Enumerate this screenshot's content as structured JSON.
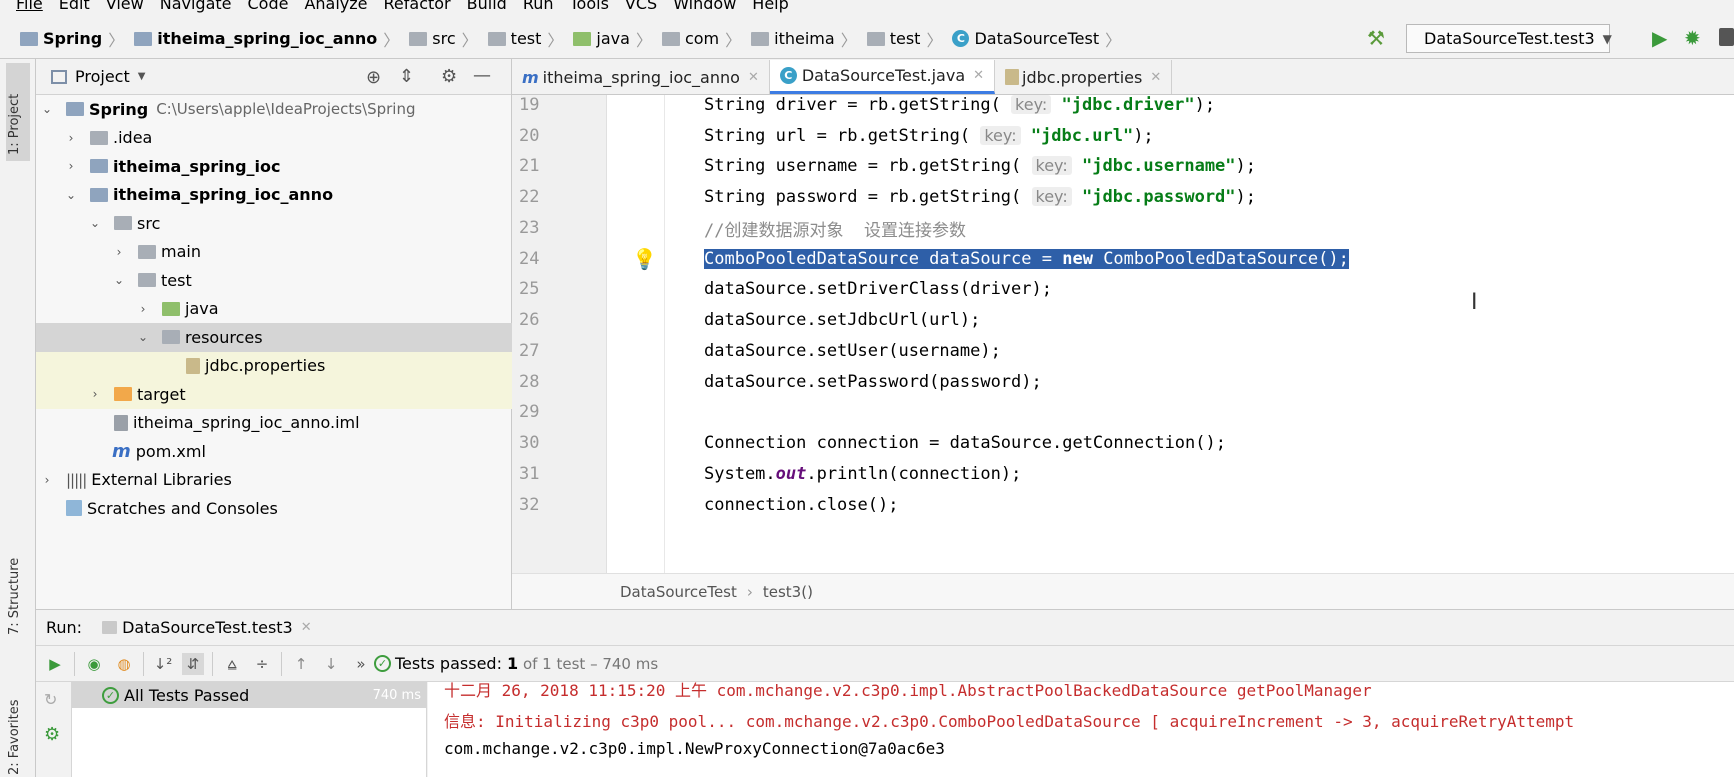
{
  "menu": [
    "File",
    "Edit",
    "View",
    "Navigate",
    "Code",
    "Analyze",
    "Refactor",
    "Build",
    "Run",
    "Tools",
    "VCS",
    "Window",
    "Help"
  ],
  "breadcrumb": [
    "Spring",
    "itheima_spring_ioc_anno",
    "src",
    "test",
    "java",
    "com",
    "itheima",
    "test",
    "DataSourceTest"
  ],
  "run_config": "DataSourceTest.test3",
  "side_tabs": {
    "project": "1: Project",
    "structure": "7: Structure",
    "favorites": "2: Favorites"
  },
  "project_panel": {
    "title": "Project",
    "tree": [
      {
        "label": "Spring",
        "path": "C:\\Users\\apple\\IdeaProjects\\Spring"
      },
      {
        "label": ".idea"
      },
      {
        "label": "itheima_spring_ioc"
      },
      {
        "label": "itheima_spring_ioc_anno"
      },
      {
        "label": "src"
      },
      {
        "label": "main"
      },
      {
        "label": "test"
      },
      {
        "label": "java"
      },
      {
        "label": "resources"
      },
      {
        "label": "jdbc.properties"
      },
      {
        "label": "target"
      },
      {
        "label": "itheima_spring_ioc_anno.iml"
      },
      {
        "label": "pom.xml"
      },
      {
        "label": "External Libraries"
      },
      {
        "label": "Scratches and Consoles"
      }
    ]
  },
  "editor_tabs": [
    "itheima_spring_ioc_anno",
    "DataSourceTest.java",
    "jdbc.properties"
  ],
  "code": {
    "lines": [
      {
        "n": "19",
        "a": "String driver = rb.getString( ",
        "hint": "key:",
        "s": "\"jdbc.driver\"",
        "b": ");"
      },
      {
        "n": "20",
        "a": "String url = rb.getString( ",
        "hint": "key:",
        "s": "\"jdbc.url\"",
        "b": ");"
      },
      {
        "n": "21",
        "a": "String username = rb.getString( ",
        "hint": "key:",
        "s": "\"jdbc.username\"",
        "b": ");"
      },
      {
        "n": "22",
        "a": "String password = rb.getString( ",
        "hint": "key:",
        "s": "\"jdbc.password\"",
        "b": ");"
      },
      {
        "n": "23",
        "comment": "//创建数据源对象  设置连接参数"
      },
      {
        "n": "24",
        "a": "ComboPooledDataSource dataSource = ",
        "kw": "new",
        "b": " ComboPooledDataSource();"
      },
      {
        "n": "25",
        "text": "dataSource.setDriverClass(driver);"
      },
      {
        "n": "26",
        "text": "dataSource.setJdbcUrl(url);"
      },
      {
        "n": "27",
        "text": "dataSource.setUser(username);"
      },
      {
        "n": "28",
        "text": "dataSource.setPassword(password);"
      },
      {
        "n": "29",
        "text": ""
      },
      {
        "n": "30",
        "text": "Connection connection = dataSource.getConnection();"
      },
      {
        "n": "31",
        "a": "System.",
        "fld": "out",
        "b": ".println(connection);"
      },
      {
        "n": "32",
        "text": "connection.close();"
      }
    ]
  },
  "editor_breadcrumb": [
    "DataSourceTest",
    "test3()"
  ],
  "run": {
    "label": "Run:",
    "tab": "DataSourceTest.test3",
    "status_prefix": "Tests passed: ",
    "status_count": "1",
    "status_suffix": " of 1 test – 740 ms",
    "tree_item": "All Tests Passed",
    "tree_time": "740 ms",
    "console": [
      "十二月 26, 2018 11:15:20 上午 com.mchange.v2.c3p0.impl.AbstractPoolBackedDataSource getPoolManager",
      "信息: Initializing c3p0 pool... com.mchange.v2.c3p0.ComboPooledDataSource [ acquireIncrement -> 3, acquireRetryAttempt",
      "com.mchange.v2.c3p0.impl.NewProxyConnection@7a0ac6e3"
    ]
  }
}
